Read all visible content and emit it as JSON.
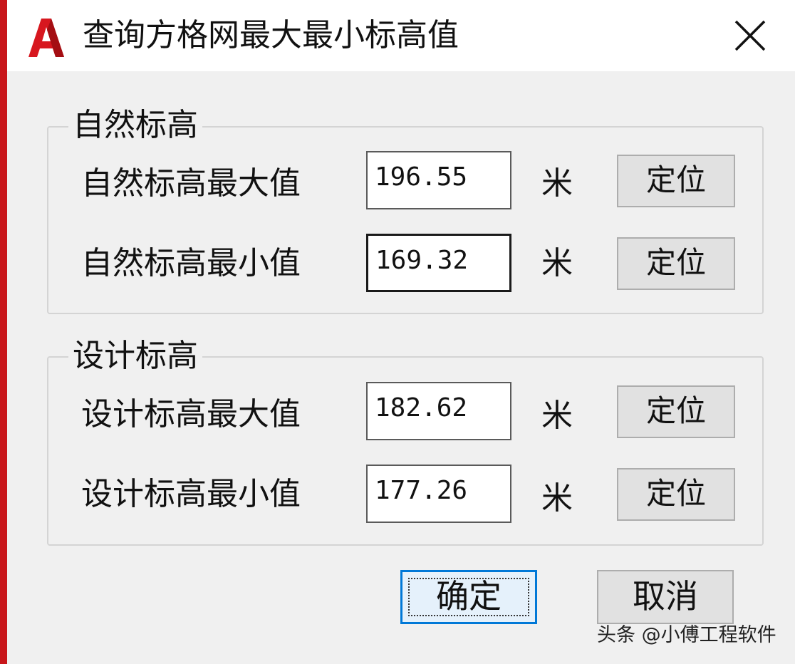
{
  "window": {
    "title": "查询方格网最大最小标高值",
    "logo_icon": "autocad-logo-icon",
    "close_icon": "close-icon",
    "accent_color": "#c8161b"
  },
  "natural_group": {
    "title": "自然标高",
    "rows": [
      {
        "label": "自然标高最大值",
        "value": "196.55",
        "unit": "米",
        "button": "定位"
      },
      {
        "label": "自然标高最小值",
        "value": "169.32",
        "unit": "米",
        "button": "定位"
      }
    ]
  },
  "design_group": {
    "title": "设计标高",
    "rows": [
      {
        "label": "设计标高最大值",
        "value": "182.62",
        "unit": "米",
        "button": "定位"
      },
      {
        "label": "设计标高最小值",
        "value": "177.26",
        "unit": "米",
        "button": "定位"
      }
    ]
  },
  "footer": {
    "ok_label": "确定",
    "cancel_label": "取消",
    "ok_border_color": "#0078d7"
  },
  "watermark": "头条 @小傅工程软件"
}
